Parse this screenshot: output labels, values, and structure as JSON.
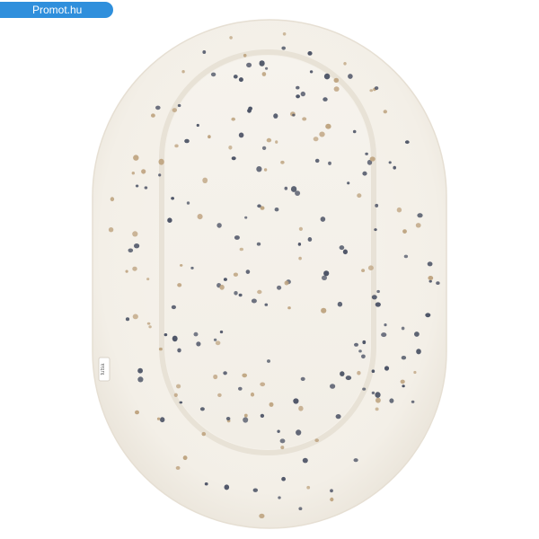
{
  "watermark": {
    "label": "Promot.hu"
  },
  "product": {
    "tag_text": "tutsa",
    "colors": {
      "fabric": "#f5f1ea",
      "shadow": "#e4ddd1",
      "dot_navy": "#4d5466",
      "dot_tan": "#bfa582",
      "badge": "#2f8fdc"
    }
  }
}
